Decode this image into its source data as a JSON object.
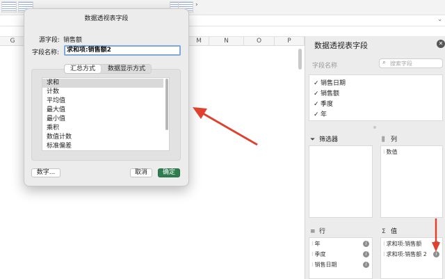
{
  "columns": [
    "G",
    "",
    "",
    "",
    "",
    "",
    "M",
    "N",
    "O",
    "P"
  ],
  "colors": {
    "accent_green": "#2e7d4f",
    "arrow_red": "#e0402e"
  },
  "dialog": {
    "title": "数据透视表字段",
    "source_label": "源字段:",
    "source_value": "销售额",
    "field_name_label": "字段名称:",
    "field_name_value": "求和项:销售额2",
    "tabs": [
      "汇总方式",
      "数据显示方式"
    ],
    "active_tab": 0,
    "summary_items": [
      "求和",
      "计数",
      "平均值",
      "最大值",
      "最小值",
      "乘积",
      "数值计数",
      "标准偏差"
    ],
    "selected_item": 0,
    "number_button": "数字...",
    "cancel_button": "取消",
    "ok_button": "确定"
  },
  "pane": {
    "title": "数据透视表字段",
    "close_icon": "close-icon",
    "field_name_header": "字段名称",
    "search_placeholder": "搜索字段",
    "fields": [
      {
        "label": "销售日期",
        "checked": true
      },
      {
        "label": "销售额",
        "checked": true
      },
      {
        "label": "季度",
        "checked": true
      },
      {
        "label": "年",
        "checked": true
      }
    ],
    "filter_label": "筛选器",
    "columns_label": "列",
    "columns_items": [
      "数值"
    ],
    "rows_label": "行",
    "rows_items": [
      "年",
      "季度",
      "销售日期"
    ],
    "values_label": "值",
    "values_items": [
      "求和项:销售额",
      "求和项:销售额 2"
    ]
  }
}
